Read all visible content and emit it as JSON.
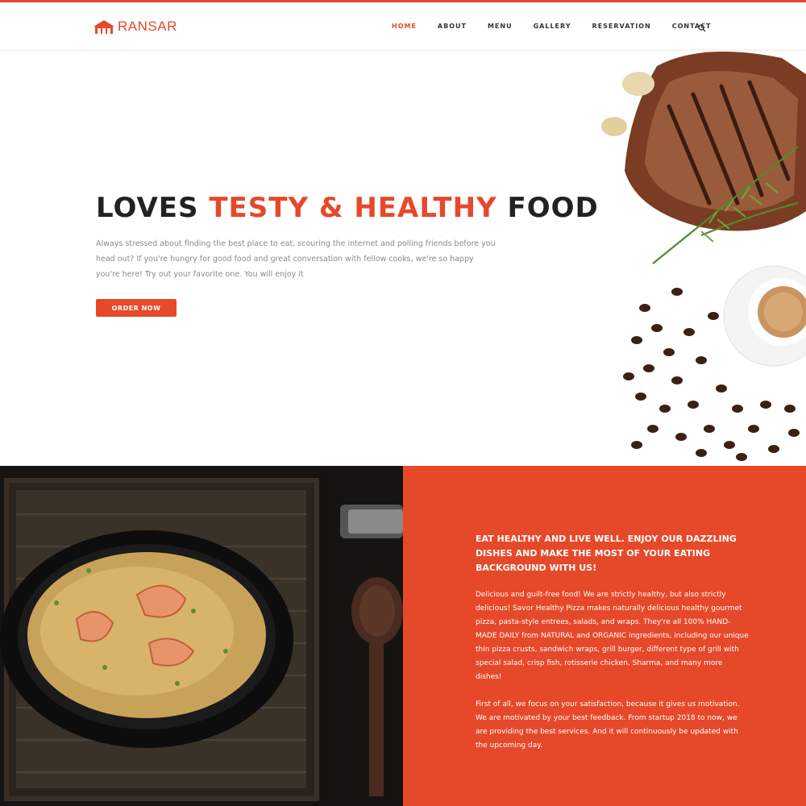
{
  "brand": {
    "name": "RANSAR",
    "accent": "#e6492a"
  },
  "nav": {
    "items": [
      "HOME",
      "ABOUT",
      "MENU",
      "GALLERY",
      "RESERVATION",
      "CONTACT"
    ],
    "active": "HOME",
    "search_icon": "search-icon"
  },
  "hero": {
    "title_part1": "LOVES ",
    "title_accent": "TESTY & HEALTHY",
    "title_part2": " FOOD",
    "description": "Always stressed about finding the best place to eat, scouring the internet and polling friends before you head out? If you're hungry for good food and great conversation with fellow cooks, we're so happy you're here! Try out your favorite one. You will enjoy it",
    "button": "ORDER NOW"
  },
  "about": {
    "heading": "EAT HEALTHY AND LIVE WELL. ENJOY OUR DAZZLING DISHES AND MAKE THE MOST OF YOUR EATING BACKGROUND WITH US!",
    "paragraph1": "Delicious and guilt-free food! We are strictly healthy, but also strictly delicious! Savor Healthy Pizza makes naturally delicious healthy gourmet pizza, pasta-style entrees, salads, and wraps. They're all 100% HAND-MADE DAILY from NATURAL and ORGANIC ingredients, including our unique thin pizza crusts, sandwich wraps, grill burger, different type of grill with special salad, crisp fish, rotisserie chicken, Sharma, and many more dishes!",
    "paragraph2": "First of all, we focus on your satisfaction, because it gives us motivation. We are motivated by your best feedback. From startup 2018 to now, we are providing the best services. And it will continuously be updated with the upcoming day."
  }
}
